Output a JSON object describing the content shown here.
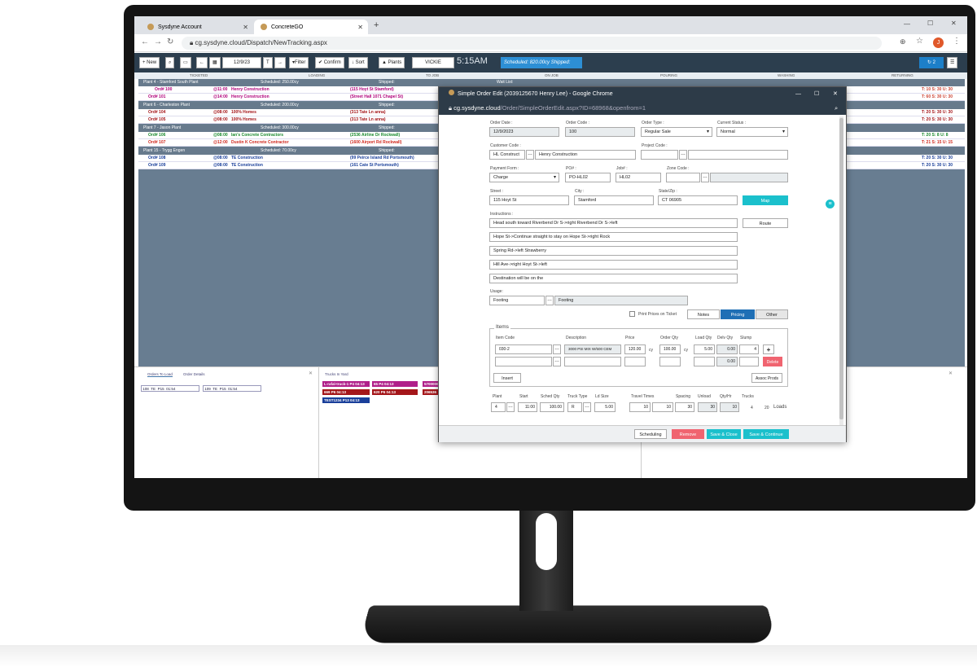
{
  "browser": {
    "tabs": [
      {
        "label": "Sysdyne Account"
      },
      {
        "label": "ConcreteGO"
      }
    ],
    "url": "cg.sysdyne.cloud/Dispatch/NewTracking.aspx",
    "profile_initial": "J"
  },
  "toolbar": {
    "new": "+ New",
    "date": "12/9/23",
    "t": "T",
    "filter": "Filter",
    "confirm": "Confirm",
    "sort": "Sort",
    "plants": "Plants",
    "user": "VICKIE",
    "time": "5:15AM",
    "scheduled": "Scheduled: 820.00cy Shipped:",
    "badge": "2"
  },
  "columns": [
    "TICKETED",
    "LOADING",
    "TO JOB",
    "ON JOB",
    "POURING",
    "WASHING",
    "RETURNING"
  ],
  "plants": [
    {
      "header": "Plant 4 - Stamford South Plant",
      "scheduled": "Scheduled: 250.00cy",
      "shipped": "Shipped:",
      "waitlist": "Wait List:",
      "orders": [
        {
          "num": "Ord# 100",
          "time": "@11:00",
          "cust": "Henry Construction",
          "addr": "(115 Hoyt St Stamford)",
          "right": "T: 10 S: 30 U: 30",
          "color": "#b0007a"
        },
        {
          "num": "Ord# 101",
          "time": "@14:00",
          "cust": "Henry Construction",
          "addr": "(Street Hall 1071 Chapel St)",
          "right": "T: 60 S: 30 U: 30",
          "color": "#b0007a"
        }
      ]
    },
    {
      "header": "Plant 6 - Charleston Plant",
      "scheduled": "Scheduled: 200.00cy",
      "shipped": "Shipped:",
      "orders": [
        {
          "num": "Ord# 104",
          "time": "@08:00",
          "cust": "100% Homes",
          "addr": "(313 Tate Ln anna)",
          "right": "T: 20 S: 30 U: 30",
          "color": "#a4161a"
        },
        {
          "num": "Ord# 105",
          "time": "@08:00",
          "cust": "100% Homes",
          "addr": "(313 Tate Ln anna)",
          "right": "T: 20 S: 30 U: 30",
          "color": "#a4161a"
        }
      ]
    },
    {
      "header": "Plant 7 - Jason Plant",
      "scheduled": "Scheduled: 300.00cy",
      "shipped": "Shipped:",
      "orders": [
        {
          "num": "Ord# 106",
          "time": "@08:00",
          "cust": "Ian's Concrete Contractors",
          "addr": "(2536 Airline Dr Rockwall)",
          "right": "T: 20 S: 8 U: 8",
          "color": "#1b8a2e"
        },
        {
          "num": "Ord# 107",
          "time": "@12:00",
          "cust": "Dustin K Concrete Contractor",
          "addr": "(1600 Airport Rd Rockwall)",
          "right": "T: 21 S: 15 U: 15",
          "color": "#d0281e"
        }
      ]
    },
    {
      "header": "Plant 15 - Trygg Engen",
      "scheduled": "Scheduled: 70.00cy",
      "shipped": "Shipped:",
      "orders": [
        {
          "num": "Ord# 108",
          "time": "@08:00",
          "cust": "TE Construction",
          "addr": "(99 Peirce Island Rd Portsmouth)",
          "right": "T: 20 S: 30 U: 30",
          "color": "#1a3f9a"
        },
        {
          "num": "Ord# 109",
          "time": "@08:00",
          "cust": "TE Construction",
          "addr": "(161 Cate St Portsmouth)",
          "right": "T: 20 S: 30 U: 30",
          "color": "#1a3f9a"
        }
      ]
    }
  ],
  "bottom": {
    "tabs": [
      "Orders To Load",
      "Order Details"
    ],
    "load_rows": [
      [
        "108",
        "TE",
        "P15",
        "01:54"
      ],
      [
        "109",
        "TE",
        "P15",
        "01:54"
      ]
    ],
    "trucks_tab": "Trucks In Yard",
    "chips": [
      {
        "text": "L-rafal-truck-1 P4 04:13",
        "color": "#b0208a"
      },
      {
        "text": "65 P4 04:13",
        "color": "#b0208a"
      },
      {
        "text": "5700000",
        "color": "#b0208a"
      },
      {
        "text": "669 P6 04:13",
        "color": "#a4161a"
      },
      {
        "text": "620 P6 04:13",
        "color": "#a4161a"
      },
      {
        "text": "206536",
        "color": "#a4161a"
      },
      {
        "text": "TEST1234 P13 04:13",
        "color": "#1a3f9a"
      }
    ]
  },
  "popup": {
    "title": "Simple Order Edit (2039125670 Henry Lee) - Google Chrome",
    "url_host": "cg.sysdyne.cloud",
    "url_path": "/Order/SimpleOrderEdit.aspx?ID=68968&openfrom=1",
    "order_date_label": "Order Date :",
    "order_date": "12/9/2023",
    "order_code_label": "Order Code :",
    "order_code": "100",
    "order_type_label": "Order Type :",
    "order_type": "Regular Sale",
    "status_label": "Current Status :",
    "status": "Normal",
    "customer_label": "Customer Code :",
    "customer_code": "HL Construct",
    "customer_name": "Henry Construction",
    "project_label": "Project Code :",
    "payment_label": "Payment Form :",
    "payment": "Charge",
    "po_label": "PO# :",
    "po": "PO-HL02",
    "job_label": "Job# :",
    "job": "HL02",
    "zone_label": "Zone Code :",
    "street_label": "Street :",
    "street": "115 Hoyt St",
    "city_label": "City :",
    "city": "Stamford",
    "statezip_label": "State/Zip :",
    "statezip": "CT 06905",
    "map": "Map",
    "route": "Route",
    "instructions_label": "Instructions :",
    "instructions": [
      "Head south toward Riverbend Dr S->right Riverbend Dr S->left",
      "Hope St->Continue straight to stay on Hope St->right Rock",
      "Spring Rd->left Strawberry",
      "Hill Ave->right Hoyt St->left",
      "Destination will be on the"
    ],
    "usage_label": "Usage:",
    "usage_code": "Footing",
    "usage_desc": "Footing",
    "print_prices": "Print Prices on Ticket",
    "notes": "Notes",
    "pricing": "Pricing",
    "other": "Other",
    "items_legend": "Items",
    "item_headers": {
      "code": "Item Code",
      "desc": "Description",
      "price": "Price",
      "qty": "Order Qty",
      "loadqty": "Load Qty",
      "delvqty": "Delv Qty",
      "slump": "Slump"
    },
    "item": {
      "code": "030-2",
      "desc": "3000 PSI MIX W/500 CEM",
      "price": "120.00",
      "unit": "cy",
      "qty": "100.00",
      "unit2": "cy",
      "loadqty": "5.00",
      "delvqty": "0.00",
      "slump": "4"
    },
    "item2": {
      "delvqty": "0.00"
    },
    "plus": "+",
    "delete": "Delete",
    "insert": "Insert",
    "assoc": "Assoc Prods",
    "sched_headers": {
      "plant": "Plant",
      "start": "Start",
      "schedqty": "Sched Qty",
      "trucktype": "Truck Type",
      "ldsize": "Ld Size",
      "travel": "Travel Times",
      "spacing": "Spacing",
      "unload": "Unload",
      "qtyhr": "Qty/Hr",
      "trucks": "Trucks"
    },
    "sched": {
      "plant": "4",
      "start": "11:00",
      "schedqty": "100.00",
      "trucktype": "R",
      "ldsize": "5.00",
      "travel1": "10",
      "travel2": "10",
      "spacing": "30",
      "unload": "30",
      "qtyhr": "10",
      "trucks": "4",
      "loads": "20",
      "loads_label": "Loads"
    },
    "footer": {
      "scheduling": "Scheduling",
      "remove": "Remove",
      "save_close": "Save & Close",
      "save_continue": "Save & Continue"
    }
  }
}
